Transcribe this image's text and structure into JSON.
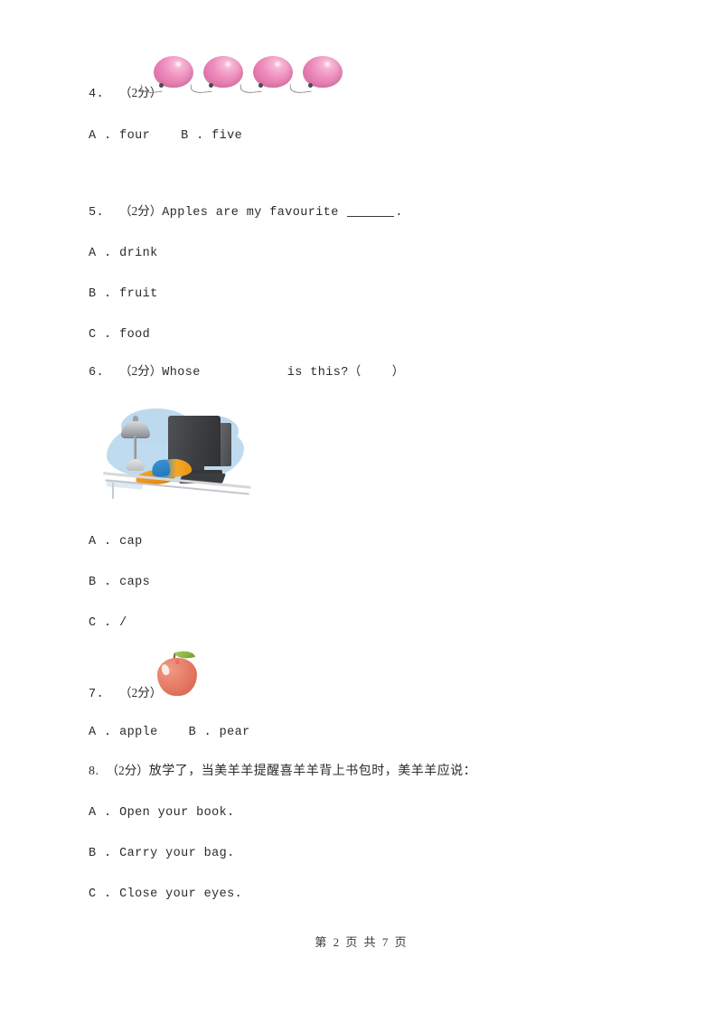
{
  "document": {
    "type": "exam-paper",
    "language": "zh-CN/en",
    "page_background": "#ffffff",
    "text_color": "#2b2b2b"
  },
  "questions": [
    {
      "number": "4.",
      "marks": "（2分）",
      "stem": "",
      "image": {
        "name": "balloons-image",
        "description": "four pink balloons with strings",
        "count": 4,
        "color": "#ee8ebd"
      },
      "options": [
        {
          "letter": "A",
          "separator": ".",
          "text": "four"
        },
        {
          "letter": "B",
          "separator": ".",
          "text": "five"
        }
      ],
      "options_inline": true
    },
    {
      "number": "5.",
      "marks": "（2分）",
      "stem_before_blank": "Apples are my favourite ",
      "stem_after_blank": ".",
      "options": [
        {
          "letter": "A",
          "separator": ".",
          "text": "drink"
        },
        {
          "letter": "B",
          "separator": ".",
          "text": "fruit"
        },
        {
          "letter": "C",
          "separator": ".",
          "text": "food"
        }
      ],
      "options_inline": false
    },
    {
      "number": "6.",
      "marks": "（2分）",
      "stem_before_gap": "Whose",
      "stem_after_gap": "is this?（    ）",
      "image": {
        "name": "desk-cap-image",
        "description": "desk lamp, computer monitor, keyboard and an orange and blue cap on a desk",
        "colors": [
          "#bcd9ee",
          "#3c3e41",
          "#f5a623",
          "#2a7fc4",
          "#a9acb0"
        ]
      },
      "options": [
        {
          "letter": "A",
          "separator": ".",
          "text": "cap"
        },
        {
          "letter": "B",
          "separator": ".",
          "text": "caps"
        },
        {
          "letter": "C",
          "separator": ".",
          "text": "/"
        }
      ],
      "options_inline": false
    },
    {
      "number": "7.",
      "marks": "（2分）",
      "stem": "",
      "image": {
        "name": "apple-image",
        "description": "a red apple with a green leaf",
        "color": "#e8836c",
        "leaf_color": "#8bb544"
      },
      "options": [
        {
          "letter": "A",
          "separator": ".",
          "text": "apple"
        },
        {
          "letter": "B",
          "separator": ".",
          "text": "pear"
        }
      ],
      "options_inline": true
    },
    {
      "number": "8.",
      "marks": "（2分）",
      "stem": "放学了，当美羊羊提醒喜羊羊背上书包时，美羊羊应说：",
      "options": [
        {
          "letter": "A",
          "separator": ".",
          "text": "Open your book."
        },
        {
          "letter": "B",
          "separator": ".",
          "text": "Carry your bag."
        },
        {
          "letter": "C",
          "separator": ".",
          "text": "Close your eyes."
        }
      ],
      "options_inline": false
    }
  ],
  "footer": {
    "text": "第 2 页 共 7 页",
    "page_number": "2",
    "total_pages": "7"
  }
}
